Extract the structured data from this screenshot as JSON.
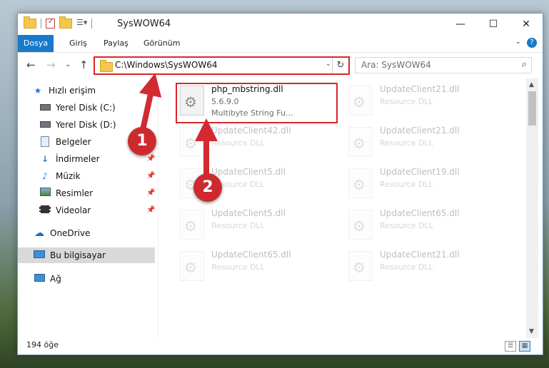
{
  "window": {
    "title": "SysWOW64",
    "controls": {
      "minimize": "—",
      "maximize": "☐",
      "close": "✕"
    }
  },
  "ribbon": {
    "tabs": [
      "Dosya",
      "Giriş",
      "Paylaş",
      "Görünüm"
    ],
    "help": "?"
  },
  "address": {
    "path": "C:\\Windows\\SysWOW64",
    "search_placeholder": "Ara: SysWOW64"
  },
  "sidebar": {
    "items": [
      {
        "label": "Hızlı erişim",
        "icon": "star-icon"
      },
      {
        "label": "Yerel Disk (C:)",
        "icon": "drive-icon"
      },
      {
        "label": "Yerel Disk (D:)",
        "icon": "drive-icon"
      },
      {
        "label": "Belgeler",
        "icon": "documents-icon"
      },
      {
        "label": "İndirmeler",
        "icon": "download-icon"
      },
      {
        "label": "Müzik",
        "icon": "music-icon"
      },
      {
        "label": "Resimler",
        "icon": "pictures-icon"
      },
      {
        "label": "Videolar",
        "icon": "videos-icon"
      },
      {
        "label": "OneDrive",
        "icon": "cloud-icon"
      },
      {
        "label": "Bu bilgisayar",
        "icon": "computer-icon"
      },
      {
        "label": "Ağ",
        "icon": "network-icon"
      }
    ]
  },
  "files": [
    {
      "name": "php_mbstring.dll",
      "line2": "5.6.9.0",
      "line3": "Multibyte String Fu..."
    },
    {
      "name": "UpdateClient21.dll",
      "line2": "Resource DLL"
    },
    {
      "name": "UpdateClient42.dll",
      "line2": "Resource DLL"
    },
    {
      "name": "UpdateClient21.dll",
      "line2": "Resource DLL"
    },
    {
      "name": "UpdateClient5.dll",
      "line2": "Resource DLL"
    },
    {
      "name": "UpdateClient19.dll",
      "line2": "Resource DLL"
    },
    {
      "name": "UpdateClient5.dll",
      "line2": "Resource DLL"
    },
    {
      "name": "UpdateClient65.dll",
      "line2": "Resource DLL"
    },
    {
      "name": "UpdateClient65.dll",
      "line2": "Resource DLL"
    },
    {
      "name": "UpdateClient21.dll",
      "line2": "Resource DLL"
    }
  ],
  "status": {
    "item_count": "194 öğe"
  },
  "callouts": [
    "1",
    "2"
  ],
  "colors": {
    "accent": "#1979ca",
    "highlight_red": "#d9262c",
    "callout_red": "#cc2a2f"
  }
}
